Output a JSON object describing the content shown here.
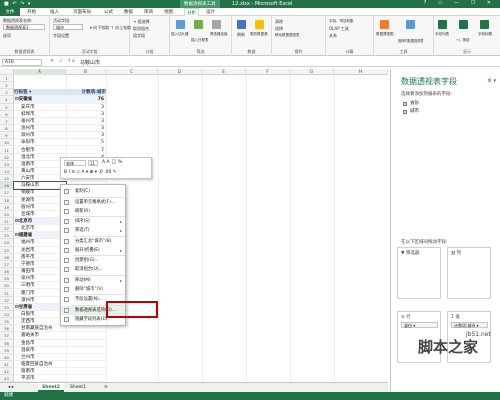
{
  "titlebar": {
    "quick_access": "■ ↶ ↷ ▾",
    "context_tab": "数据透视表工具",
    "title": "12.xlsx - Microsoft Excel",
    "window_controls": "? ▭ — ☐ ✕"
  },
  "tabs": {
    "file": "文件",
    "items": [
      "开始",
      "插入",
      "页面布局",
      "公式",
      "数据",
      "审阅",
      "视图",
      "分析",
      "设计"
    ]
  },
  "ribbon": {
    "pivot_name_label": "数据透视表名称:",
    "pivot_name_value": "数据透视表1",
    "options": "选项",
    "active_field_label": "活动字段:",
    "active_field_value": "城市",
    "field_settings": "字段设置",
    "expand_field": "▾ 向下钻取 ↑ 向上钻取",
    "group_selection": "→ 组选择",
    "ungroup": "取消组合",
    "group_field": "组字段",
    "insert_slicer": "插入切片器",
    "insert_timeline": "插入日程表",
    "filter_connections": "筛选器连接",
    "refresh": "刷新",
    "change_source": "更改数据源",
    "clear": "清除",
    "select": "选择",
    "move": "移动数据透视表",
    "fields_items_sets": "字段、项目和集",
    "olap_tools": "OLAP 工具",
    "relationships": "关系",
    "pivot_chart": "数据透视图",
    "recommended": "推荐的数据透视表",
    "field_list": "字段列表",
    "buttons": "+/- 按钮",
    "field_headers": "字段标题",
    "group_labels": [
      "数据透视表",
      "活动字段",
      "分组",
      "筛选",
      "数据",
      "操作",
      "计算",
      "工具",
      "显示"
    ]
  },
  "formulabar": {
    "namebox": "A16",
    "fx": "✕ ✓ fx",
    "value": "马鞍山市"
  },
  "columns": [
    "A",
    "B",
    "C",
    "D",
    "E",
    "F",
    "G",
    "H"
  ],
  "rows": [
    "1",
    "2",
    "3",
    "4",
    "5",
    "6",
    "7",
    "8",
    "9",
    "10",
    "11",
    "12",
    "13",
    "14",
    "15",
    "16",
    "17",
    "18",
    "19",
    "20",
    "21",
    "22",
    "23",
    "24",
    "25",
    "26",
    "27",
    "28",
    "29",
    "30",
    "31",
    "32",
    "33",
    "34",
    "35",
    "36",
    "37",
    "38",
    "39",
    "40",
    "41",
    "42",
    "43"
  ],
  "pivot": {
    "header_label": "行标签 ▾",
    "header_count": "计数项:城市",
    "rows": [
      {
        "label": "⊟安徽省",
        "value": "76",
        "level": 0
      },
      {
        "label": "安庆市",
        "value": "3",
        "level": 1
      },
      {
        "label": "蚌埠市",
        "value": "3",
        "level": 1
      },
      {
        "label": "亳州市",
        "value": "3",
        "level": 1
      },
      {
        "label": "池州市",
        "value": "3",
        "level": 1
      },
      {
        "label": "滁州市",
        "value": "3",
        "level": 1
      },
      {
        "label": "阜阳市",
        "value": "5",
        "level": 1
      },
      {
        "label": "合肥市",
        "value": "7",
        "level": 1
      },
      {
        "label": "淮北市",
        "value": "4",
        "level": 1
      },
      {
        "label": "淮南市",
        "value": "4",
        "level": 1
      },
      {
        "label": "黄山市",
        "value": "4",
        "level": 1
      },
      {
        "label": "六安市",
        "value": "7",
        "level": 1
      },
      {
        "label": "马鞍山市",
        "value": "",
        "level": 1
      },
      {
        "label": "铜陵市",
        "value": "",
        "level": 1
      },
      {
        "label": "芜湖市",
        "value": "",
        "level": 1
      },
      {
        "label": "宿州市",
        "value": "",
        "level": 1
      },
      {
        "label": "宣城市",
        "value": "",
        "level": 1
      },
      {
        "label": "⊟北京市",
        "value": "6",
        "level": 0
      },
      {
        "label": "北京市",
        "value": "6",
        "level": 1
      },
      {
        "label": "⊟福建省",
        "value": "66",
        "level": 0
      },
      {
        "label": "福州市",
        "value": "",
        "level": 1
      },
      {
        "label": "龙岩市",
        "value": "",
        "level": 1
      },
      {
        "label": "南平市",
        "value": "",
        "level": 1
      },
      {
        "label": "宁德市",
        "value": "",
        "level": 1
      },
      {
        "label": "莆田市",
        "value": "",
        "level": 1
      },
      {
        "label": "泉州市",
        "value": "",
        "level": 1
      },
      {
        "label": "三明市",
        "value": "",
        "level": 1
      },
      {
        "label": "厦门市",
        "value": "",
        "level": 1
      },
      {
        "label": "漳州市",
        "value": "",
        "level": 1
      },
      {
        "label": "⊟甘肃省",
        "value": "",
        "level": 0
      },
      {
        "label": "白银市",
        "value": "",
        "level": 1
      },
      {
        "label": "定西市",
        "value": "",
        "level": 1
      },
      {
        "label": "甘南藏族自治州",
        "value": "",
        "level": 1
      },
      {
        "label": "嘉峪关市",
        "value": "",
        "level": 1
      },
      {
        "label": "金昌市",
        "value": "",
        "level": 1
      },
      {
        "label": "酒泉市",
        "value": "",
        "level": 1
      },
      {
        "label": "兰州市",
        "value": "",
        "level": 1
      },
      {
        "label": "临夏回族自治州",
        "value": "",
        "level": 1
      },
      {
        "label": "陇南市",
        "value": "",
        "level": 1
      },
      {
        "label": "平凉市",
        "value": "",
        "level": 1
      },
      {
        "label": "庆阳市",
        "value": "",
        "level": 1
      }
    ]
  },
  "mini_toolbar": {
    "font": "宋体",
    "size": "11",
    "buttons_row1": "A A 📋 %",
    "buttons_row2": "B I ≡ ◇ A ▾ ⊞ ▾ .0 .00 ✎"
  },
  "context_menu": {
    "items": [
      {
        "label": "复制(C)",
        "arrow": ""
      },
      {
        "label": "设置单元格格式(F)...",
        "arrow": ""
      },
      {
        "label": "刷新(R)",
        "arrow": ""
      },
      {
        "label": "排序(S)",
        "arrow": "▸"
      },
      {
        "label": "筛选(T)",
        "arrow": "▸"
      },
      {
        "label": "分类汇总“城市”(B)",
        "arrow": ""
      },
      {
        "label": "展开/折叠(E)",
        "arrow": "▸"
      },
      {
        "label": "创建组(G)...",
        "arrow": ""
      },
      {
        "label": "取消组合(U)...",
        "arrow": ""
      },
      {
        "label": "移动(M)",
        "arrow": "▸"
      },
      {
        "label": "删除“城市”(V)",
        "arrow": ""
      },
      {
        "label": "字段设置(N)...",
        "arrow": ""
      },
      {
        "label": "数据透视表选项(O)...",
        "arrow": ""
      },
      {
        "label": "隐藏字段列表(D)",
        "arrow": ""
      }
    ]
  },
  "sheets": {
    "nav": "◂ ▸",
    "tabs": [
      "Sheet2",
      "Sheet1"
    ],
    "add": "⊕"
  },
  "statusbar": {
    "text": "就绪"
  },
  "pane": {
    "title": "数据透视表字段",
    "subtitle": "选择要添加到报表的字段:",
    "gear": "⚙ ▾",
    "fields": [
      {
        "label": "省份",
        "checked": "✓"
      },
      {
        "label": "城市",
        "checked": "✓"
      }
    ],
    "drag_hint": "在以下区域间拖动字段:",
    "zones": [
      {
        "label": "▼ 筛选器",
        "chip": ""
      },
      {
        "label": "▥ 列",
        "chip": ""
      },
      {
        "label": "≡ 行",
        "chip": "省份 ▾"
      },
      {
        "label": "Σ 值",
        "chip": "计数项:城市 ▾"
      }
    ]
  },
  "watermark": {
    "main": "脚本之家",
    "url": "jb51.net"
  }
}
